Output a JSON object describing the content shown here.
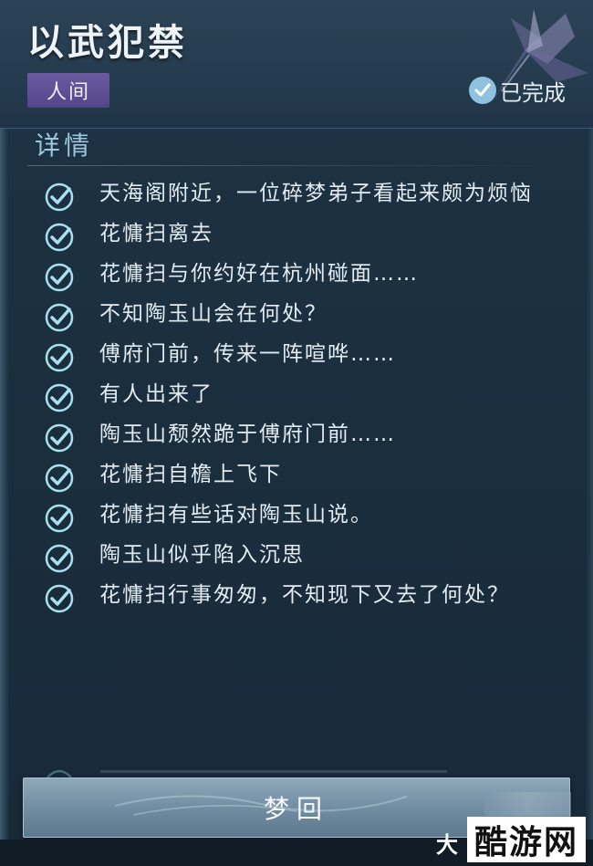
{
  "header": {
    "title": "以武犯禁",
    "tag": "人间",
    "status": "已完成"
  },
  "details": {
    "section_title": "详情",
    "items": [
      {
        "text": "天海阁附近，一位碎梦弟子看起来颇为烦恼",
        "completed": true
      },
      {
        "text": "花慵扫离去",
        "completed": true
      },
      {
        "text": "花慵扫与你约好在杭州碰面……",
        "completed": true
      },
      {
        "text": "不知陶玉山会在何处？",
        "completed": true
      },
      {
        "text": "傅府门前，传来一阵喧哗……",
        "completed": true
      },
      {
        "text": "有人出来了",
        "completed": true
      },
      {
        "text": "陶玉山颓然跪于傅府门前……",
        "completed": true
      },
      {
        "text": "花慵扫自檐上飞下",
        "completed": true
      },
      {
        "text": "花慵扫有些话对陶玉山说。",
        "completed": true
      },
      {
        "text": "陶玉山似乎陷入沉思",
        "completed": true
      },
      {
        "text": "花慵扫行事匆匆，不知现下又去了何处？",
        "completed": true
      }
    ]
  },
  "action": {
    "button_label": "梦回"
  },
  "overlay": {
    "corner_text": "大",
    "watermark": "酷游网"
  },
  "colors": {
    "tag_bg": "#5e4f95",
    "check": "#a9e0ef",
    "accent": "#9ec6dc"
  }
}
